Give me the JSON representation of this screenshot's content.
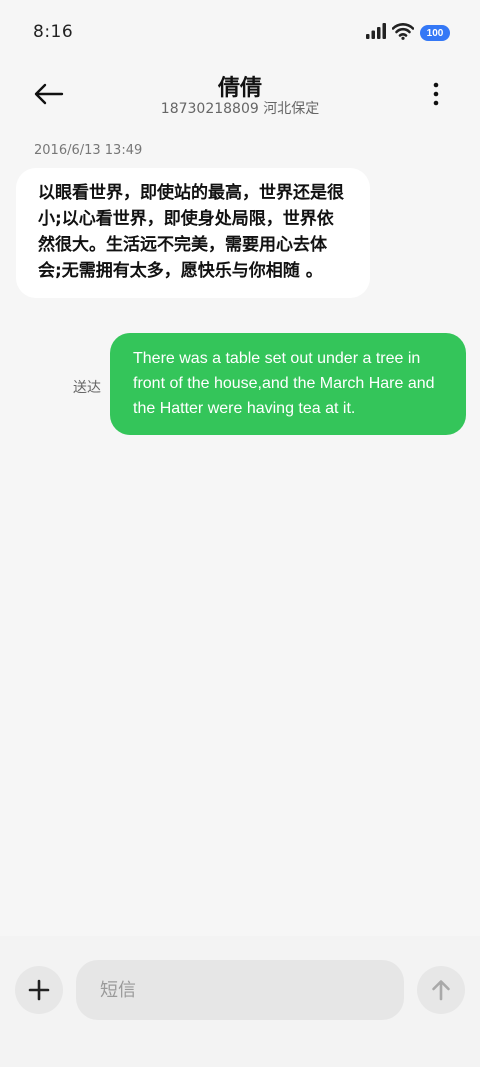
{
  "status_bar": {
    "time": "8:16",
    "battery": "100",
    "icons": [
      "signal-icon",
      "wifi-icon",
      "battery-icon"
    ]
  },
  "header": {
    "contact_name": "倩倩",
    "contact_detail": "18730218809 河北保定",
    "back_icon": "back-arrow-icon",
    "more_icon": "more-vertical-icon"
  },
  "conversation": {
    "timestamp": "2016/6/13 13:49",
    "incoming_message": "以眼看世界，即使站的最高，世界还是很小;以心看世界，即使身处局限，世界依然很大。生活远不完美，需要用心去体会;无需拥有太多，愿快乐与你相随 。",
    "outgoing_message": "There was a table set out under a tree in front of the house,and the March Hare and the Hatter were having tea at it.",
    "delivery_status": "送达"
  },
  "composer": {
    "placeholder": "短信",
    "attach_icon": "plus-icon",
    "send_icon": "send-arrow-icon"
  },
  "colors": {
    "background": "#f6f6f6",
    "incoming_bubble": "#ffffff",
    "outgoing_bubble": "#34c55a",
    "battery": "#3478f6"
  }
}
